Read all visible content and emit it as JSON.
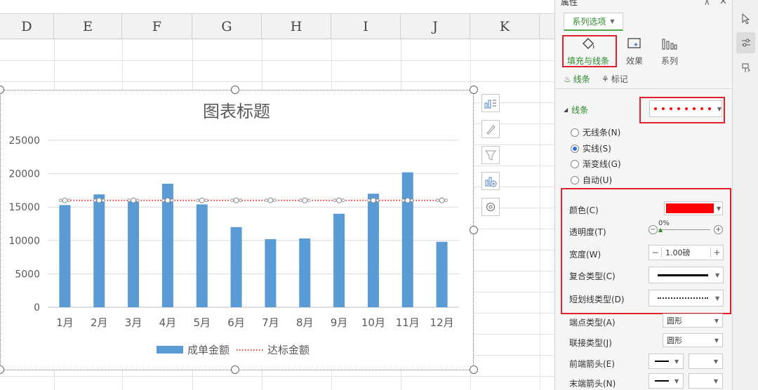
{
  "spreadsheet": {
    "columns": [
      "D",
      "E",
      "F",
      "G",
      "H",
      "I",
      "J",
      "K"
    ]
  },
  "chart_tools": {
    "icons": [
      "chart-elements-icon",
      "chart-style-icon",
      "chart-filter-icon",
      "chart-add-icon",
      "chart-settings-icon"
    ]
  },
  "panel": {
    "title": "属性",
    "tab_label": "系列选项",
    "categories": [
      {
        "label": "填充与线条",
        "icon": "fill-bucket-icon"
      },
      {
        "label": "效果",
        "icon": "effect-icon"
      },
      {
        "label": "系列",
        "icon": "series-icon"
      }
    ],
    "subtabs": [
      "线条",
      "标记"
    ],
    "section_label": "线条",
    "line_options": [
      {
        "label": "无线条(N)",
        "selected": false
      },
      {
        "label": "实线(S)",
        "selected": true
      },
      {
        "label": "渐变线(G)",
        "selected": false
      },
      {
        "label": "自动(U)",
        "selected": false
      }
    ],
    "props": {
      "color_label": "颜色(C)",
      "color_value": "#ff0000",
      "transparency_label": "透明度(T)",
      "transparency_value": "0%",
      "width_label": "宽度(W)",
      "width_value": "1.00磅",
      "compound_label": "复合类型(C)",
      "dash_label": "短划线类型(D)",
      "cap_label": "端点类型(A)",
      "cap_value": "圆形",
      "join_label": "联接类型(J)",
      "join_value": "圆形",
      "begin_arrow_label": "前端箭头(E)",
      "end_arrow_label": "末端箭头(N)"
    },
    "highlight_color": "#e0212b",
    "accent_color": "#2c8a2c"
  },
  "chart_data": {
    "type": "bar",
    "title": "图表标题",
    "categories": [
      "1月",
      "2月",
      "3月",
      "4月",
      "5月",
      "6月",
      "7月",
      "8月",
      "9月",
      "10月",
      "11月",
      "12月"
    ],
    "series": [
      {
        "name": "成单金额",
        "type": "bar",
        "color": "#5b9bd5",
        "values": [
          15300,
          16900,
          16000,
          18500,
          15400,
          12000,
          10200,
          10300,
          14000,
          17000,
          20200,
          9800
        ]
      },
      {
        "name": "达标金额",
        "type": "line",
        "style": "dotted",
        "color": "#ff0000",
        "values": [
          16000,
          16000,
          16000,
          16000,
          16000,
          16000,
          16000,
          16000,
          16000,
          16000,
          16000,
          16000
        ]
      }
    ],
    "ylim": [
      0,
      25000
    ],
    "yticks": [
      "0",
      "5000",
      "10000",
      "15000",
      "20000",
      "25000"
    ],
    "grid": true,
    "legend": "bottom"
  }
}
